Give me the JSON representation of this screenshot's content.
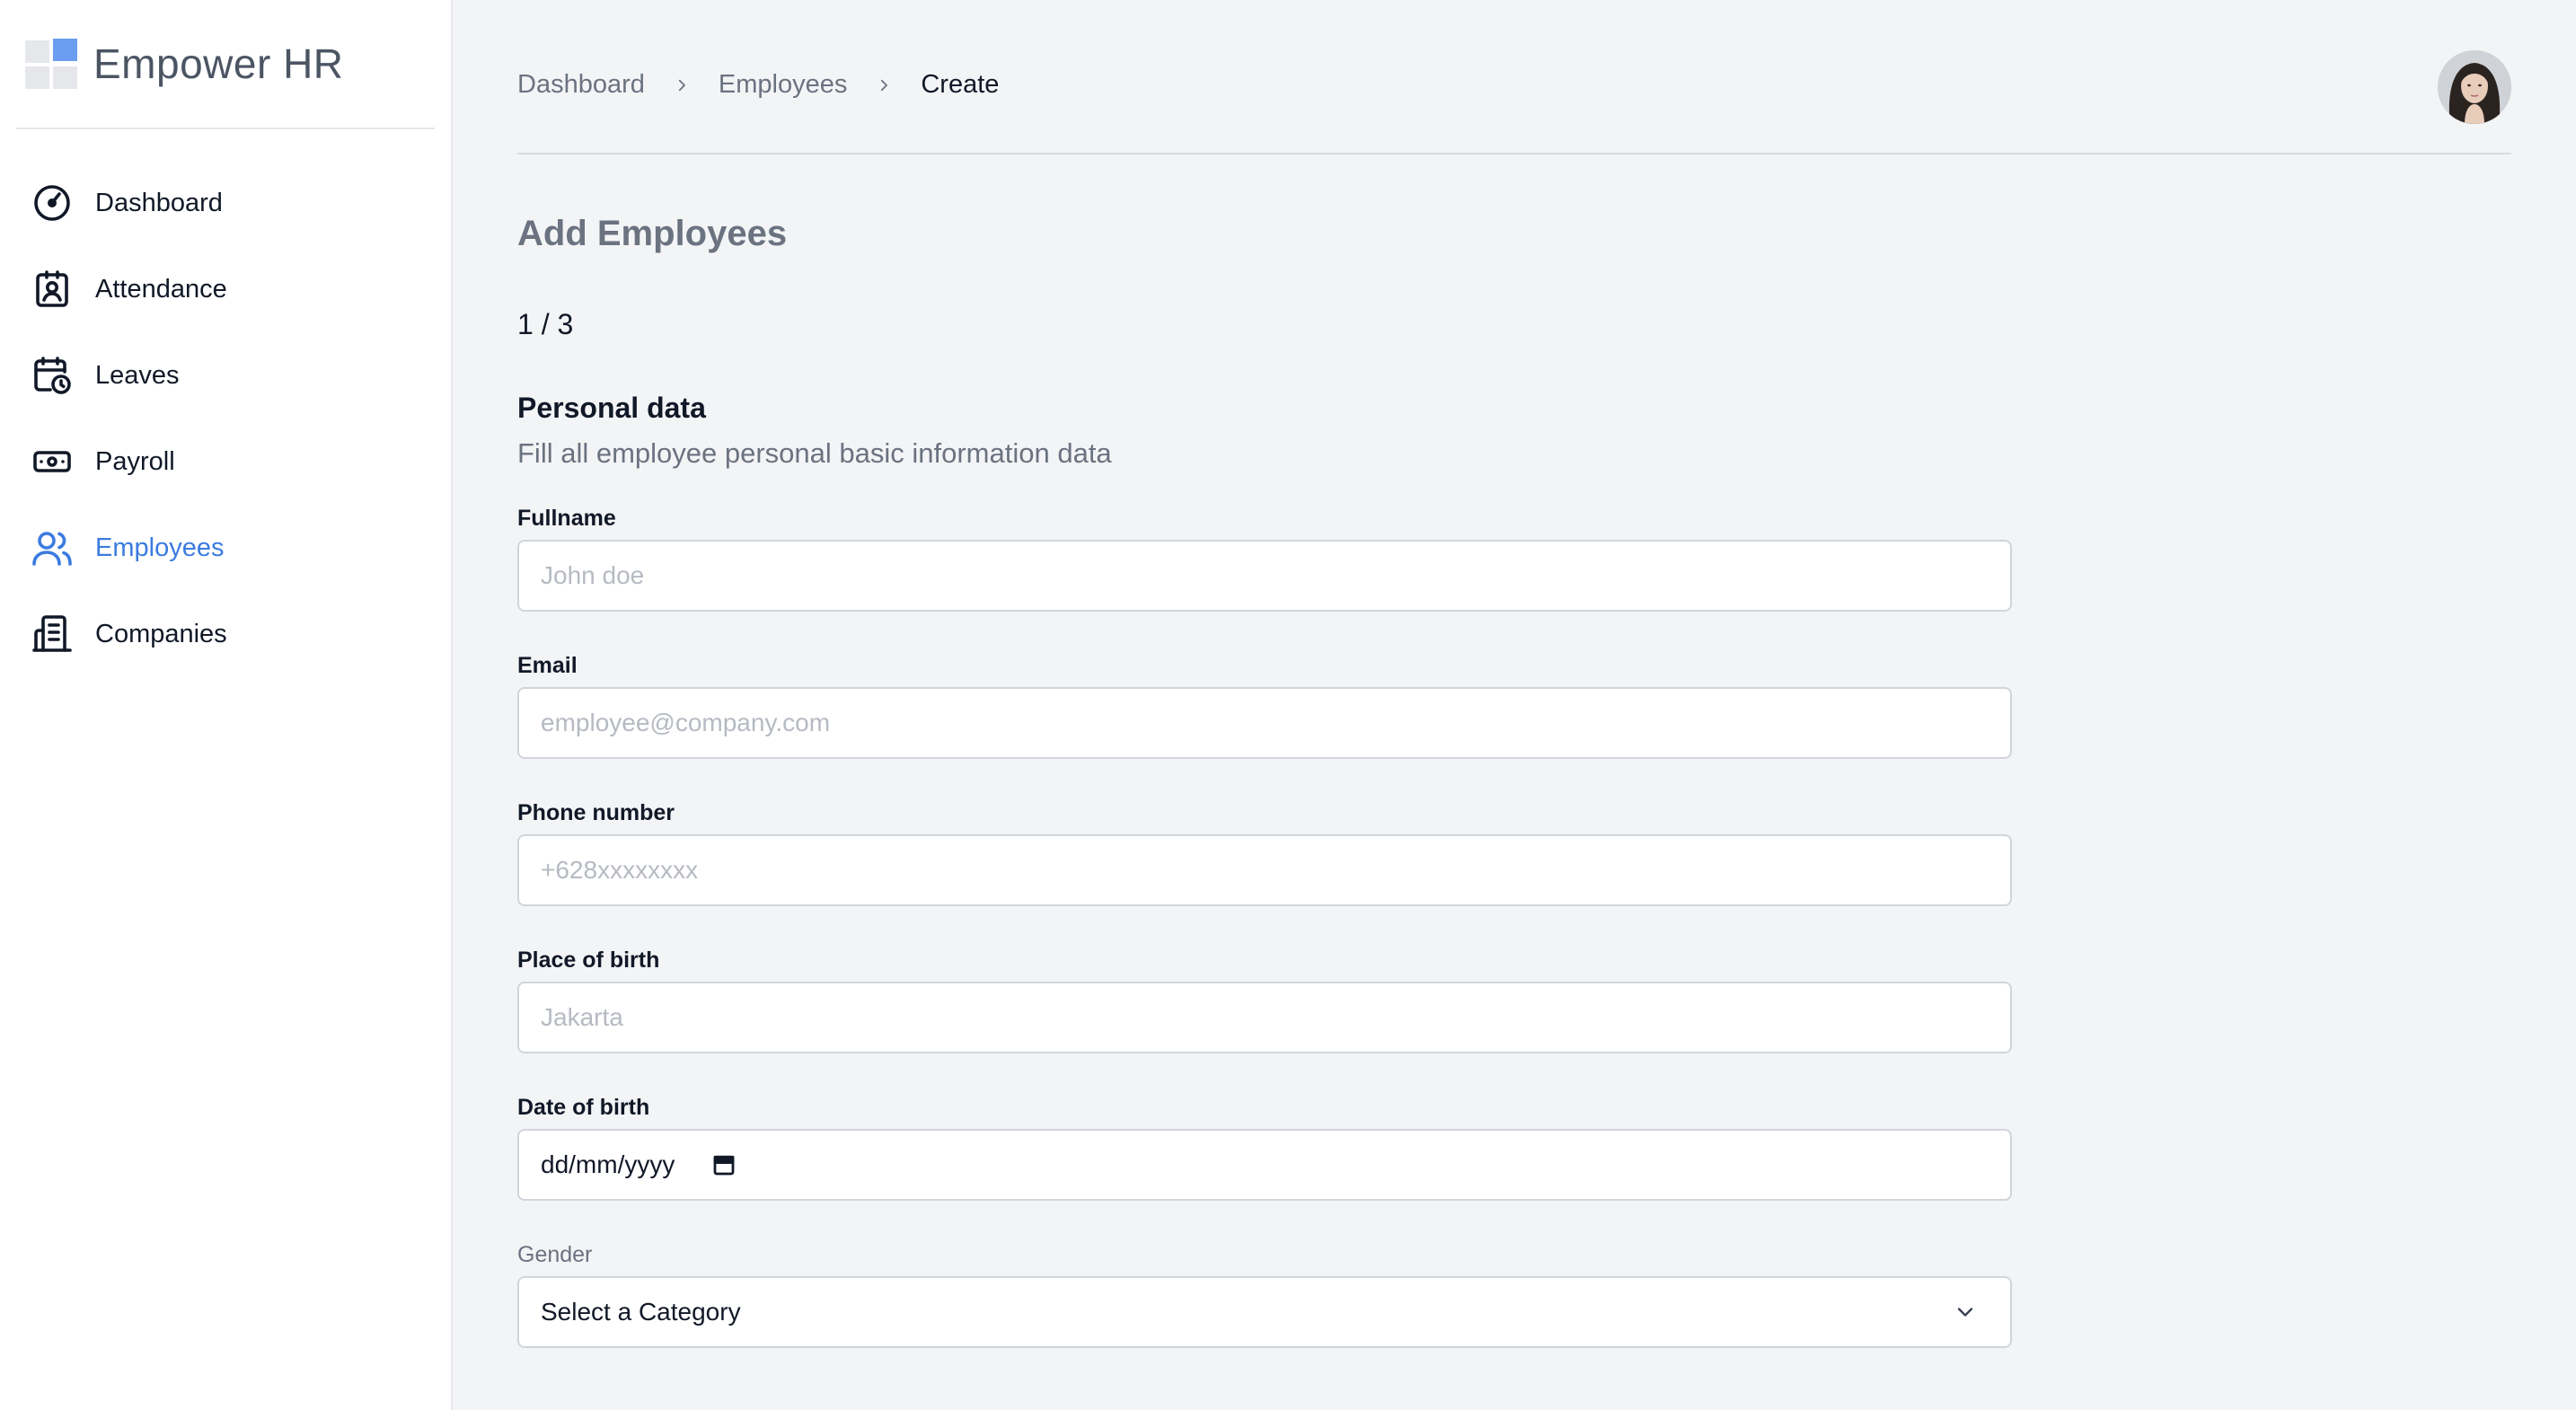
{
  "brand": {
    "name": "Empower HR"
  },
  "sidebar": {
    "items": [
      {
        "label": "Dashboard",
        "icon": "gauge-icon",
        "active": false
      },
      {
        "label": "Attendance",
        "icon": "badge-icon",
        "active": false
      },
      {
        "label": "Leaves",
        "icon": "calendar-clock-icon",
        "active": false
      },
      {
        "label": "Payroll",
        "icon": "cash-icon",
        "active": false
      },
      {
        "label": "Employees",
        "icon": "users-icon",
        "active": true
      },
      {
        "label": "Companies",
        "icon": "building-icon",
        "active": false
      }
    ]
  },
  "breadcrumb": [
    "Dashboard",
    "Employees",
    "Create"
  ],
  "page": {
    "title": "Add Employees",
    "step": "1 / 3",
    "section_title": "Personal data",
    "section_subtitle": "Fill all employee personal basic information data"
  },
  "form": {
    "fullname": {
      "label": "Fullname",
      "placeholder": "John doe",
      "value": ""
    },
    "email": {
      "label": "Email",
      "placeholder": "employee@company.com",
      "value": ""
    },
    "phone": {
      "label": "Phone number",
      "placeholder": "+628xxxxxxxx",
      "value": ""
    },
    "place_of_birth": {
      "label": "Place of birth",
      "placeholder": "Jakarta",
      "value": ""
    },
    "date_of_birth": {
      "label": "Date of birth",
      "value": "dd/mm/yyyy"
    },
    "gender": {
      "label": "Gender",
      "value": "Select a Category"
    }
  },
  "colors": {
    "accent": "#3b7be0",
    "main_bg": "#f3f4f6",
    "muted_text": "#6b7280"
  }
}
